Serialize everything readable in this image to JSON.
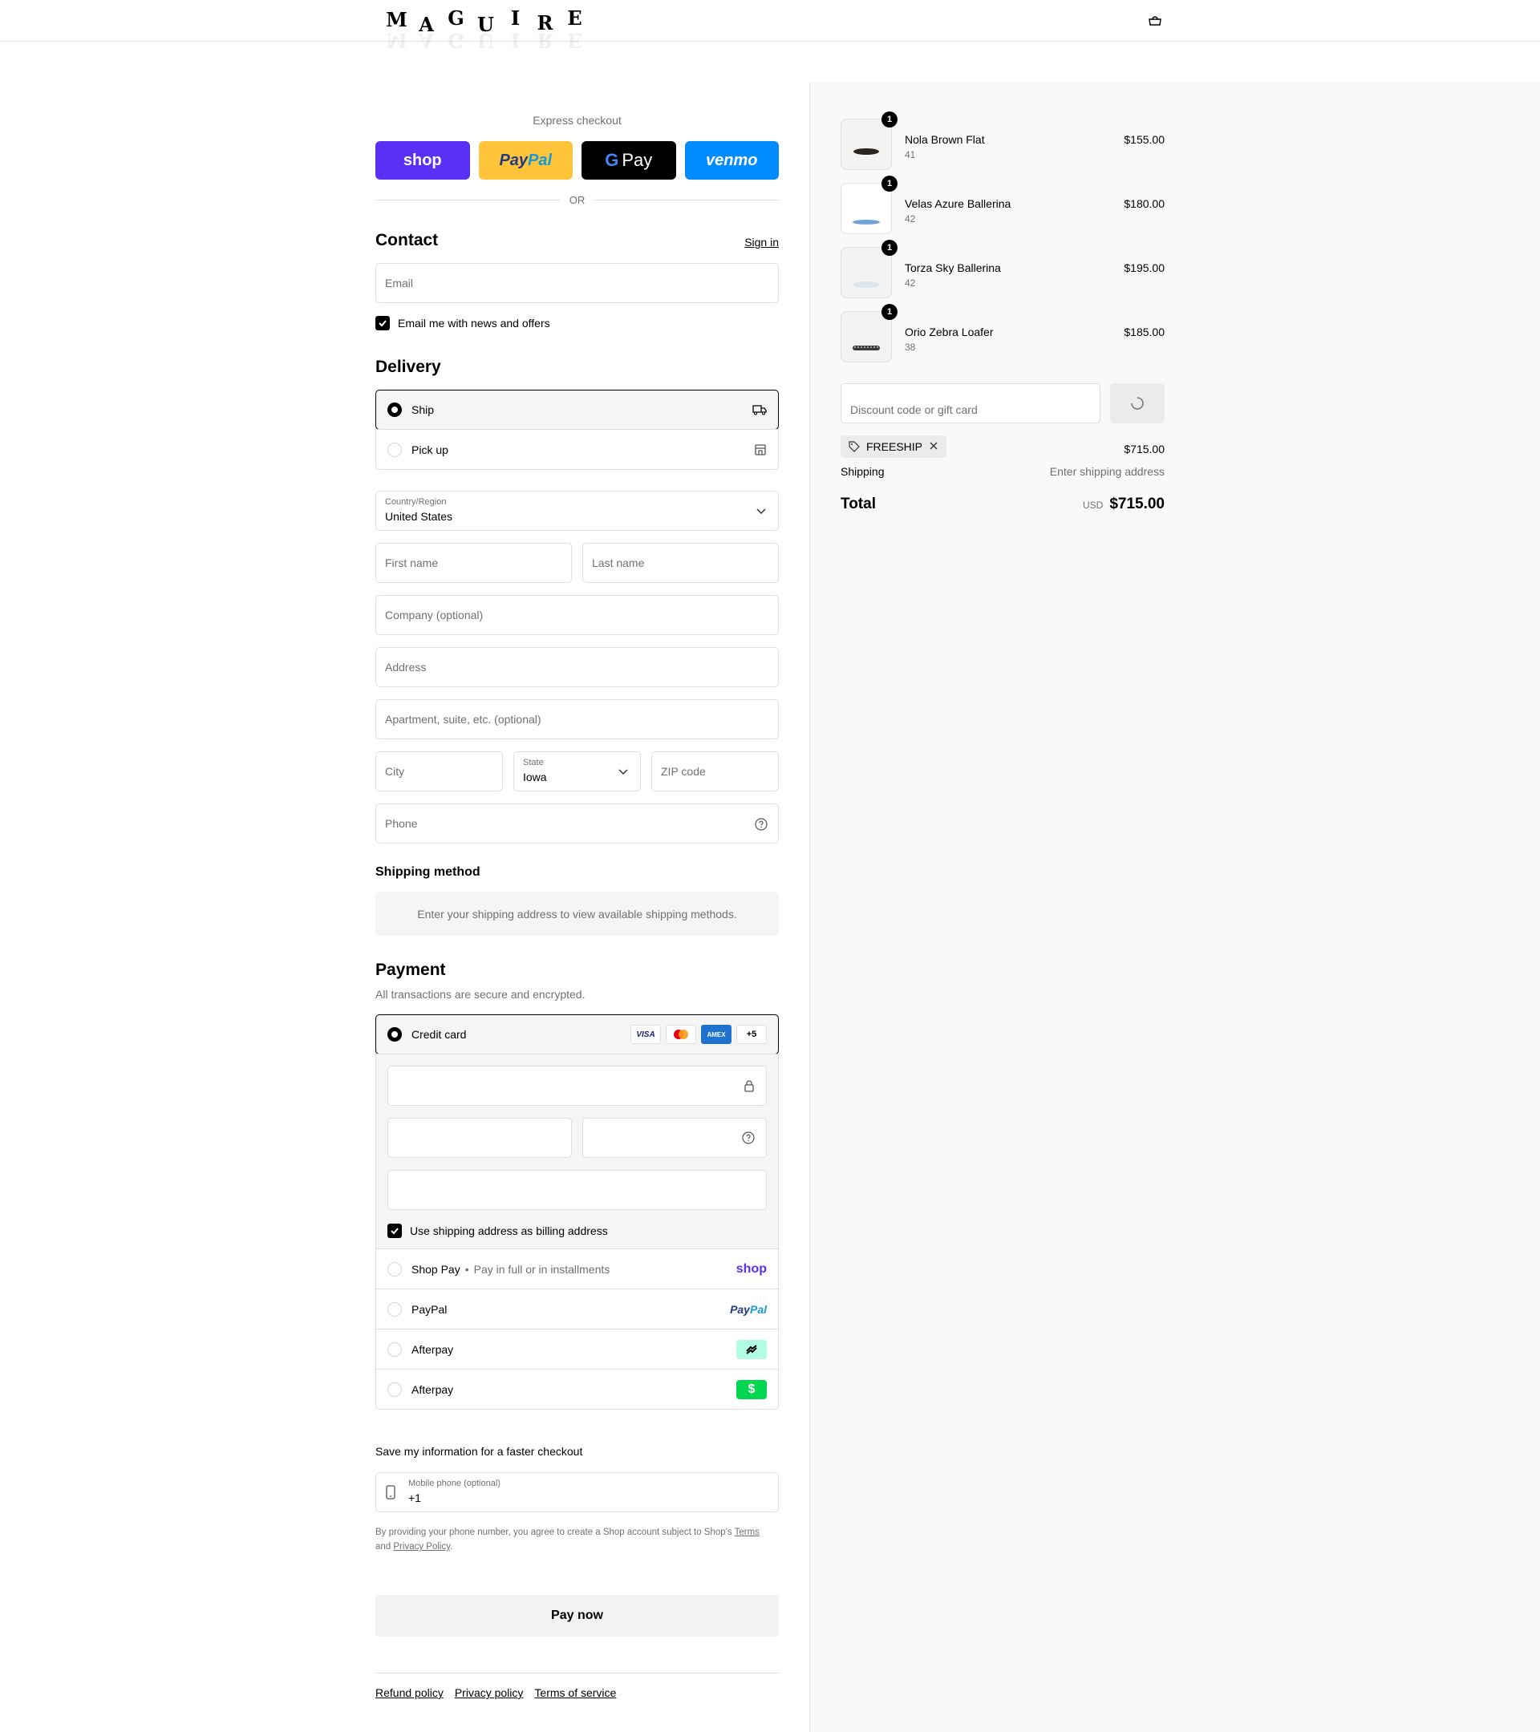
{
  "brand": {
    "letters": [
      "M",
      "A",
      "G",
      "U",
      "I",
      "R",
      "E"
    ]
  },
  "express": {
    "label": "Express checkout",
    "shop": "shop",
    "paypal_a": "Pay",
    "paypal_b": "Pal",
    "gpay": "Pay",
    "venmo": "venmo",
    "or": "OR"
  },
  "contact": {
    "title": "Contact",
    "signin": "Sign in",
    "email_placeholder": "Email",
    "newsletter": "Email me with news and offers"
  },
  "delivery": {
    "title": "Delivery",
    "options": [
      {
        "label": "Ship",
        "selected": true
      },
      {
        "label": "Pick up",
        "selected": false
      }
    ],
    "country_label": "Country/Region",
    "country_value": "United States",
    "first_name": "First name",
    "last_name": "Last name",
    "company": "Company (optional)",
    "address": "Address",
    "apartment": "Apartment, suite, etc. (optional)",
    "city": "City",
    "state_label": "State",
    "state_value": "Iowa",
    "zip": "ZIP code",
    "phone": "Phone"
  },
  "shipping_method": {
    "title": "Shipping method",
    "message": "Enter your shipping address to view available shipping methods."
  },
  "payment": {
    "title": "Payment",
    "subtitle": "All transactions are secure and encrypted.",
    "credit_card": "Credit card",
    "card_brands": [
      "VISA",
      "AMEX",
      "+5"
    ],
    "billing_same": "Use shipping address as billing address",
    "shop_pay": "Shop Pay",
    "shop_pay_note": "Pay in full or in installments",
    "shop_logo": "shop",
    "paypal": "PayPal",
    "paypal_logo_a": "Pay",
    "paypal_logo_b": "Pal",
    "afterpay_1": "Afterpay",
    "afterpay_2": "Afterpay",
    "cash_logo": "$"
  },
  "save": {
    "title": "Save my information for a faster checkout",
    "mobile_label": "Mobile phone (optional)",
    "mobile_value": "+1",
    "legal_1": "By providing your phone number, you agree to create a Shop account subject to Shop's ",
    "terms": "Terms",
    "legal_2": "and ",
    "privacy": "Privacy Policy",
    "legal_3": "."
  },
  "pay_now": "Pay now",
  "footer": [
    "Refund policy",
    "Privacy policy",
    "Terms of service"
  ],
  "summary": {
    "items": [
      {
        "name": "Nola Brown Flat",
        "variant": "41",
        "price": "$155.00",
        "qty": "1",
        "color": "#2b2420"
      },
      {
        "name": "Velas Azure Ballerina",
        "variant": "42",
        "price": "$180.00",
        "qty": "1",
        "color": "#6fa3d8"
      },
      {
        "name": "Torza Sky Ballerina",
        "variant": "42",
        "price": "$195.00",
        "qty": "1",
        "color": "#d9e6ee"
      },
      {
        "name": "Orio Zebra Loafer",
        "variant": "38",
        "price": "$185.00",
        "qty": "1",
        "color": "#3a3a3a"
      }
    ],
    "discount_placeholder": "Discount code or gift card",
    "code": "FREESHIP",
    "subtotal": "$715.00",
    "shipping_label": "Shipping",
    "shipping_value": "Enter shipping address",
    "total_label": "Total",
    "currency": "USD",
    "total": "$715.00"
  },
  "colors": {
    "shop": "#5a31f4",
    "paypal": "#ffc439",
    "venmo": "#008cff",
    "afterpay": "#b2fce4",
    "cash": "#00d64f"
  }
}
